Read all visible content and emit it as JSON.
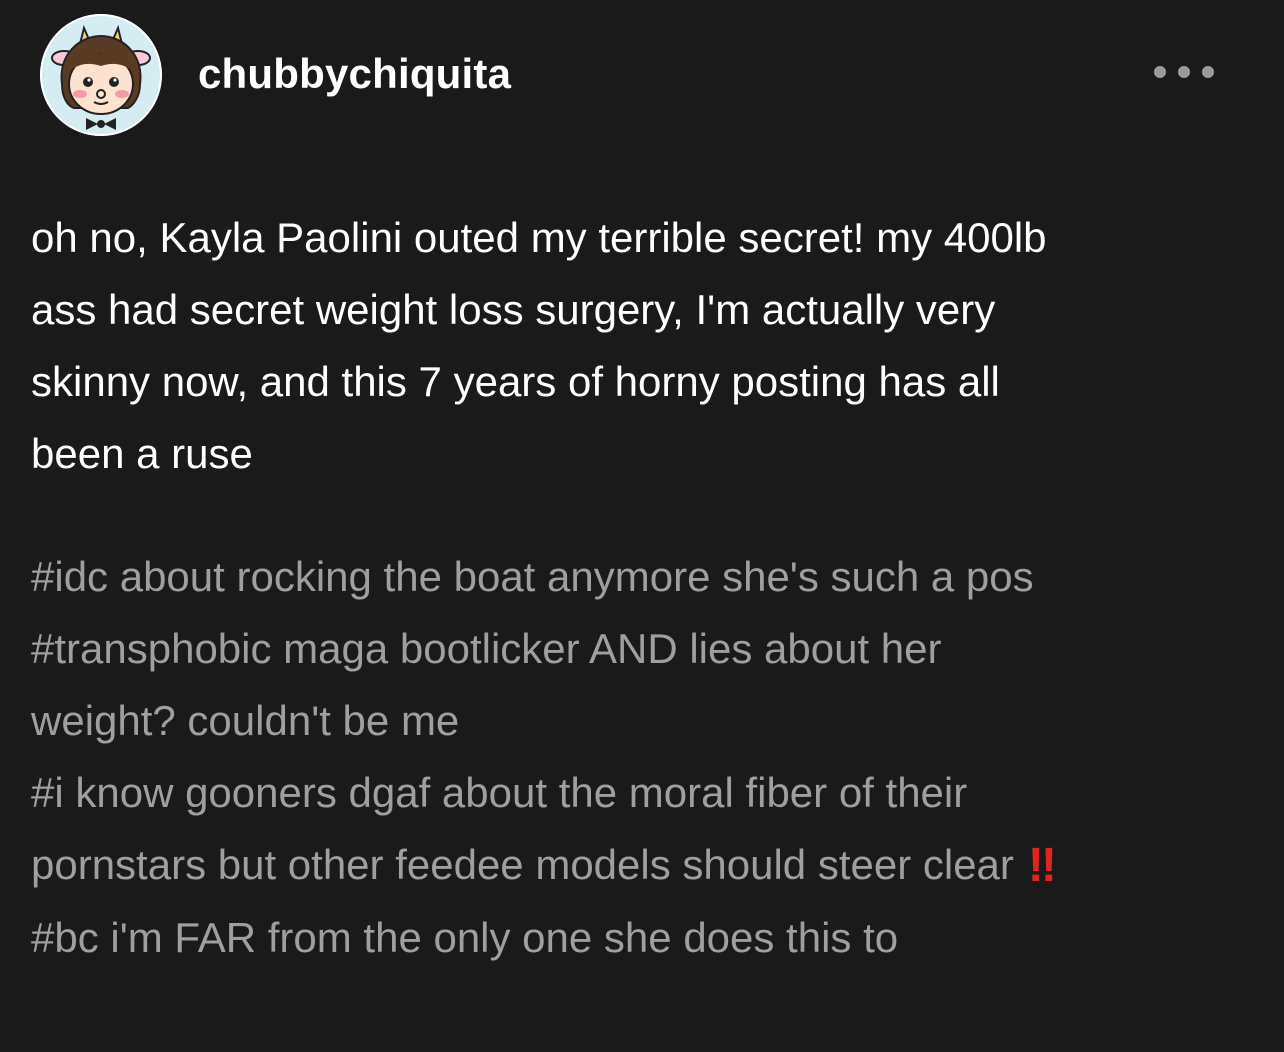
{
  "post": {
    "username": "chubbychiquita",
    "avatar_icon": "cartoon-cow-girl-avatar",
    "more_icon": "ellipsis-icon",
    "body_lines": [
      "oh no, Kayla Paolini outed my terrible secret! my 400lb",
      "ass had secret weight loss surgery, I'm actually very",
      "skinny now, and this 7 years of horny posting has all",
      "been a ruse"
    ],
    "tags": {
      "line1": "#idc about rocking the boat anymore she's such a pos",
      "line2": "#transphobic maga bootlicker AND lies about her",
      "line3": "weight? couldn't be me",
      "line4": "#i know gooners dgaf about the moral fiber of their",
      "line5": "pornstars but other feedee models should steer clear",
      "line5_emoji": "‼",
      "line6": "#bc i'm FAR from the only one she does this to"
    }
  },
  "colors": {
    "background": "#1a1a1a",
    "text": "#ffffff",
    "tag_text": "#9f9f9f",
    "alert_red": "#e0251c"
  }
}
